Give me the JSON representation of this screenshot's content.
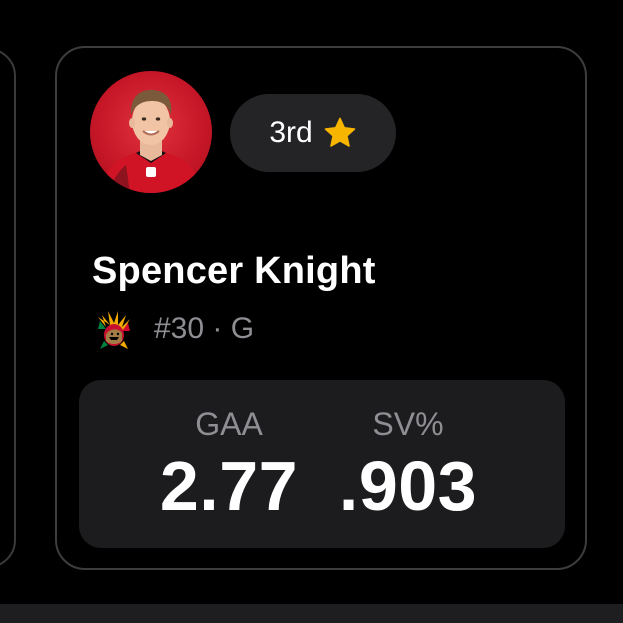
{
  "card": {
    "rank": "3rd",
    "rank_icon": "star-icon",
    "player_name": "Spencer Knight",
    "meta": "#30 · G",
    "team_logo": "chicago-blackhawks-logo-icon",
    "stats": [
      {
        "label": "GAA",
        "value": "2.77"
      },
      {
        "label": "SV%",
        "value": ".903"
      }
    ]
  },
  "colors": {
    "background": "#000000",
    "card_border": "#3d3d40",
    "pill_bg": "#242426",
    "stats_bg": "#1c1c1e",
    "muted_text": "#8e8e93",
    "star": "#f7b500",
    "avatar_bg": "#c41626"
  }
}
